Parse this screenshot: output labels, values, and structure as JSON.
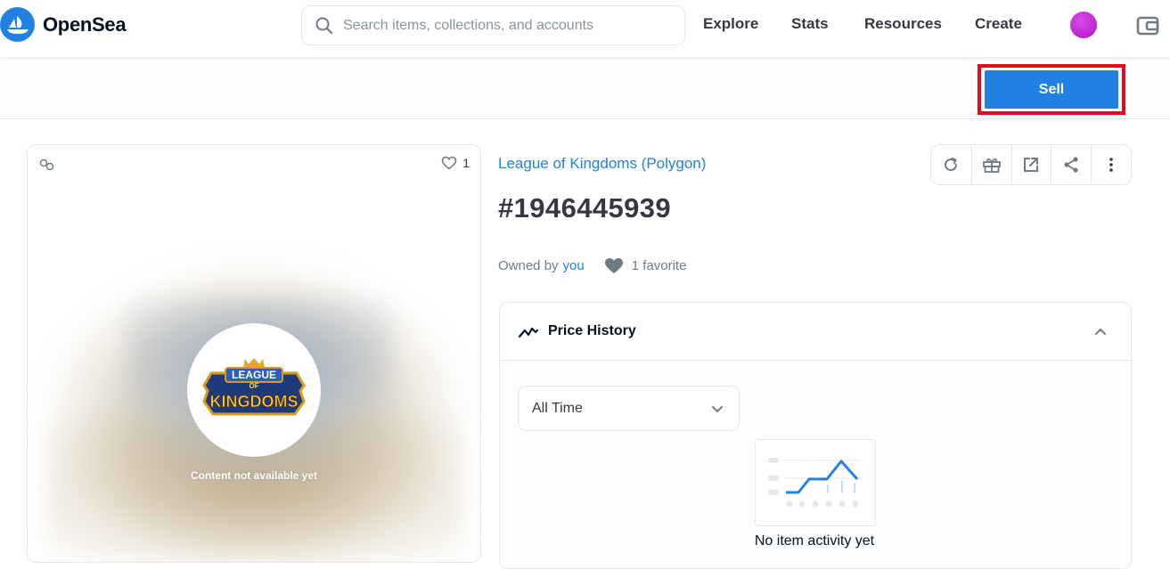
{
  "header": {
    "brand": "OpenSea",
    "search_placeholder": "Search items, collections, and accounts",
    "nav": [
      "Explore",
      "Stats",
      "Resources",
      "Create"
    ]
  },
  "subbar": {
    "sell_label": "Sell",
    "highlight_color": "#e00b1c"
  },
  "media": {
    "favorites_count": "1",
    "game_logo_text_top": "LEAGUE",
    "game_logo_text_mid": "OF",
    "game_logo_text_bottom": "KINGDOMS",
    "unavailable_text": "Content not available yet"
  },
  "item": {
    "collection": "League of Kingdoms (Polygon)",
    "title": "#1946445939",
    "owned_by_label": "Owned by",
    "owner": "you",
    "favorites_label": "1 favorite"
  },
  "toolbar": {
    "icons": [
      "refresh-icon",
      "gift-icon",
      "external-link-icon",
      "share-icon",
      "more-icon"
    ]
  },
  "price_history": {
    "title": "Price History",
    "period": "All Time",
    "empty_text": "No item activity yet"
  },
  "colors": {
    "accent": "#2081e2",
    "text": "#353840",
    "muted": "#707a83"
  }
}
